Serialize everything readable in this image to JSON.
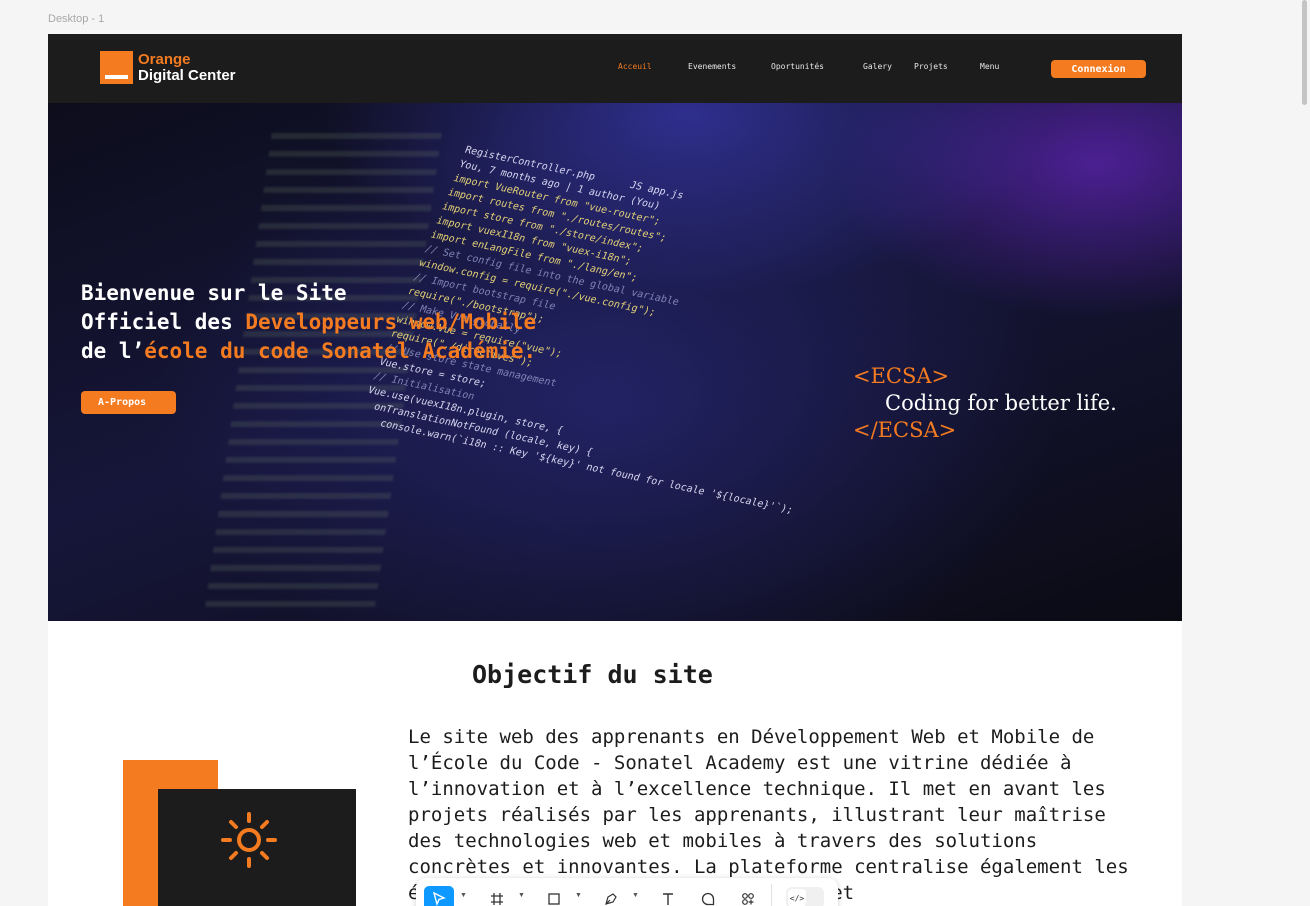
{
  "canvas": {
    "frame_label": "Desktop - 1"
  },
  "header": {
    "logo_line1": "Orange",
    "logo_line2": "Digital Center",
    "nav": [
      "Acceuil",
      "Evenements",
      "Oportunités",
      "Galery",
      "Projets",
      "Menu"
    ],
    "active_nav": "Acceuil",
    "login_label": "Connexion"
  },
  "hero": {
    "title_line1": "Bienvenue sur le Site",
    "title_line2_white": "Officiel des ",
    "title_line2_orange": "Developpeurs web/Mobile",
    "title_line3_white": "de l’",
    "title_line3_orange": "école du code Sonatel Académie.",
    "about_button": "A-Propos",
    "tagline_open": "<ECSA>",
    "tagline_text": "Coding for better life.",
    "tagline_close": "</ECSA>",
    "background_code": [
      "RegisterController.php      JS app.js",
      "You, 7 months ago | 1 author (You)",
      "import VueRouter from \"vue-router\";",
      "import routes from \"./routes/routes\";",
      "import store from \"./store/index\";",
      "import vuexI18n from \"vuex-i18n\";",
      "import enLangFile from \"./lang/en\";",
      "",
      "// Set config file into the global variable",
      "window.config = require(\"./vue.config\");",
      "",
      "// Import bootstrap file",
      "require(\"./bootstrap\");",
      "",
      "// Make Vue globally",
      "window.Vue = require(\"vue\");",
      "require(\"./directives\");",
      "",
      "// Use store state management",
      "Vue.store = store;",
      "",
      "// Initialisation",
      "Vue.use(vuexI18n.plugin, store, {",
      "  onTranslationNotFound (locale, key) {",
      "    console.warn(`i18n :: Key '${key}' not found for locale '${locale}'`);"
    ]
  },
  "objective": {
    "title": "Objectif du site",
    "text": "Le site web des apprenants en Développement Web et Mobile de l’École du Code - Sonatel Academy est une vitrine dédiée à l’innovation et à l’excellence technique. Il met en avant les projets réalisés par les apprenants, illustrant leur maîtrise des technologies web et mobiles à travers des solutions concrètes et innovantes. La plateforme centralise également les événements… favorisant le réseautage et"
  },
  "colors": {
    "accent": "#f47b20",
    "dark": "#1c1c1c",
    "selection": "#0d99ff"
  },
  "toolbar": {
    "tools": [
      "move-tool",
      "frame-tool",
      "shape-tool",
      "pen-tool",
      "text-tool",
      "comment-tool",
      "actions-tool"
    ],
    "selected": "move-tool",
    "dev_mode_icon": "code-icon"
  }
}
